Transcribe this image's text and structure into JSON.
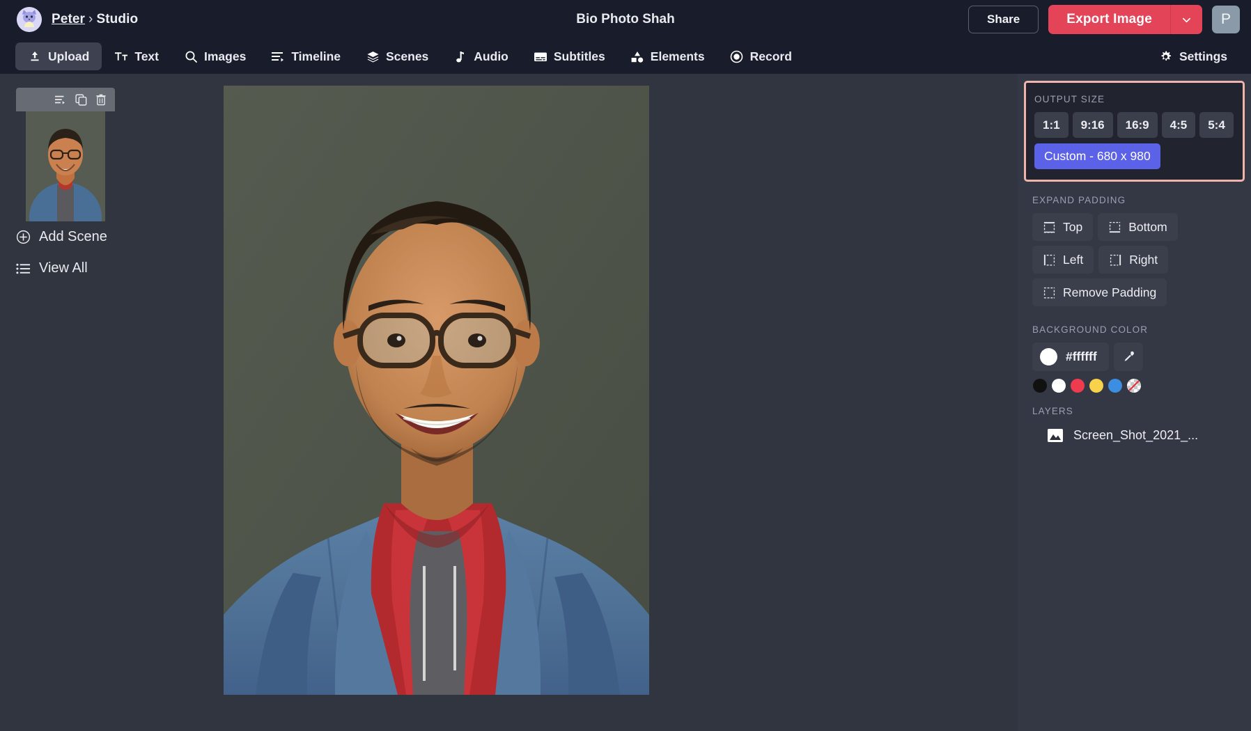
{
  "app": {
    "background": "#31353f",
    "topbar_bg": "#191d2b",
    "panel_bg": "#343744",
    "accent_red": "#e34458",
    "accent_blue": "#5b62e8",
    "highlight_border": "#f0b4ad"
  },
  "topbar": {
    "avatar_icon": "cat-avatar-icon",
    "breadcrumb_user": "Peter",
    "breadcrumb_sep": "›",
    "breadcrumb_section": "Studio",
    "document_title": "Bio Photo Shah",
    "share_label": "Share",
    "export_label": "Export Image",
    "export_caret_icon": "chevron-down-icon",
    "profile_initial": "P"
  },
  "tabs": [
    {
      "label": "Upload",
      "icon": "upload-icon",
      "active": true
    },
    {
      "label": "Text",
      "icon": "text-icon",
      "active": false
    },
    {
      "label": "Images",
      "icon": "search-icon",
      "active": false
    },
    {
      "label": "Timeline",
      "icon": "timeline-icon",
      "active": false
    },
    {
      "label": "Scenes",
      "icon": "layers-icon",
      "active": false
    },
    {
      "label": "Audio",
      "icon": "music-note-icon",
      "active": false
    },
    {
      "label": "Subtitles",
      "icon": "subtitles-icon",
      "active": false
    },
    {
      "label": "Elements",
      "icon": "shapes-icon",
      "active": false
    },
    {
      "label": "Record",
      "icon": "record-icon",
      "active": false
    }
  ],
  "settings_tab": {
    "label": "Settings",
    "icon": "gear-icon"
  },
  "sidebar": {
    "scene_toolbar": [
      {
        "icon": "timeline-icon",
        "name": "scene-timeline-icon"
      },
      {
        "icon": "duplicate-icon",
        "name": "scene-duplicate-icon"
      },
      {
        "icon": "trash-icon",
        "name": "scene-delete-icon"
      }
    ],
    "scene_thumbnail_alt": "scene-thumbnail",
    "actions": [
      {
        "label": "Add Scene",
        "icon": "plus-circle-icon"
      },
      {
        "label": "View All",
        "icon": "list-icon"
      }
    ]
  },
  "canvas": {
    "photo_alt": "portrait-photo",
    "photo_bg": "#4d5249"
  },
  "rightpanel": {
    "output_size": {
      "label": "OUTPUT SIZE",
      "highlighted": true,
      "ratios": [
        "1:1",
        "9:16",
        "16:9",
        "4:5",
        "5:4"
      ],
      "custom_label": "Custom - 680 x 980",
      "custom_selected": true
    },
    "expand_padding": {
      "label": "EXPAND PADDING",
      "buttons": [
        {
          "label": "Top",
          "icon": "pad-top-icon"
        },
        {
          "label": "Bottom",
          "icon": "pad-bottom-icon"
        },
        {
          "label": "Left",
          "icon": "pad-left-icon"
        },
        {
          "label": "Right",
          "icon": "pad-right-icon"
        },
        {
          "label": "Remove Padding",
          "icon": "pad-remove-icon"
        }
      ]
    },
    "background_color": {
      "label": "BACKGROUND COLOR",
      "value": "#ffffff",
      "eyedropper_icon": "eyedropper-icon",
      "swatches": [
        "#111111",
        "#ffffff",
        "#ef3b4e",
        "#f7d24a",
        "#3b8ee0",
        "transparent"
      ]
    },
    "layers": {
      "label": "LAYERS",
      "items": [
        {
          "name": "Screen_Shot_2021_...",
          "icon": "image-icon"
        }
      ]
    }
  }
}
